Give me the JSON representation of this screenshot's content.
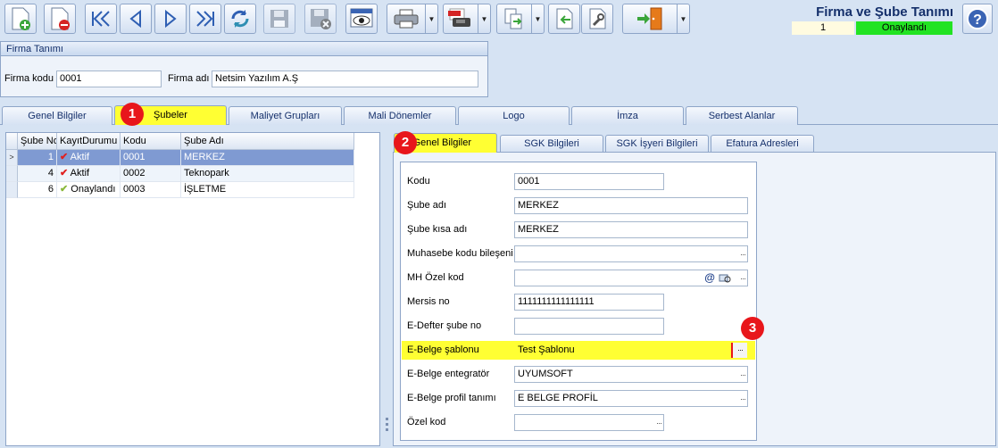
{
  "window": {
    "title": "Firma ve Şube Tanımı",
    "record_no": "1",
    "status": "Onaylandı",
    "status_color": "#22e322"
  },
  "toolbar": {
    "icons": [
      "new-document-icon",
      "delete-document-icon",
      "first-record-icon",
      "previous-record-icon",
      "next-record-icon",
      "last-record-icon",
      "refresh-icon",
      "save-icon",
      "cancel-save-icon",
      "preview-icon",
      "print-icon",
      "pdf-export-icon",
      "export-icon",
      "import-icon",
      "settings-icon",
      "exit-door-icon"
    ]
  },
  "firma": {
    "group_title": "Firma Tanımı",
    "kod_label": "Firma kodu",
    "kod_value": "0001",
    "ad_label": "Firma adı",
    "ad_value": "Netsim Yazılım A.Ş"
  },
  "main_tabs": [
    "Genel Bilgiler",
    "Şubeler",
    "Maliyet Grupları",
    "Mali Dönemler",
    "Logo",
    "İmza",
    "Serbest Alanlar"
  ],
  "main_tab_selected": 1,
  "grid": {
    "columns": [
      "Şube No",
      "KayıtDurumu",
      "Kodu",
      "Şube Adı"
    ],
    "rows": [
      {
        "no": "1",
        "durum": "Aktif",
        "kodu": "0001",
        "ad": "MERKEZ"
      },
      {
        "no": "4",
        "durum": "Aktif",
        "kodu": "0002",
        "ad": "Teknopark"
      },
      {
        "no": "6",
        "durum": "Onaylandı",
        "kodu": "0003",
        "ad": "İŞLETME"
      }
    ]
  },
  "sub_tabs": [
    "Genel Bilgiler",
    "SGK Bilgileri",
    "SGK İşyeri Bilgileri",
    "Efatura Adresleri"
  ],
  "form": {
    "kodu": {
      "label": "Kodu",
      "value": "0001"
    },
    "sube_adi": {
      "label": "Şube adı",
      "value": "MERKEZ"
    },
    "sube_kisa": {
      "label": "Şube kısa adı",
      "value": "MERKEZ"
    },
    "muhasebe": {
      "label": "Muhasebe kodu bileşeni",
      "value": ""
    },
    "mh_ozel": {
      "label": "MH Özel kod",
      "value": ""
    },
    "mersis": {
      "label": "Mersis no",
      "value": "1111111111111111"
    },
    "edefter": {
      "label": "E-Defter şube no",
      "value": ""
    },
    "ebelge_sablon": {
      "label": "E-Belge şablonu",
      "value": "Test Şablonu"
    },
    "ebelge_entegrator": {
      "label": "E-Belge entegratör",
      "value": "UYUMSOFT"
    },
    "ebelge_profil": {
      "label": "E-Belge profil tanımı",
      "value": "E BELGE PROFİL"
    },
    "ozel_kod": {
      "label": "Özel kod",
      "value": ""
    }
  },
  "markers": [
    "1",
    "2",
    "3"
  ],
  "highlight_color": "#ffff33",
  "ellipsis": "···",
  "at_symbol": "@"
}
